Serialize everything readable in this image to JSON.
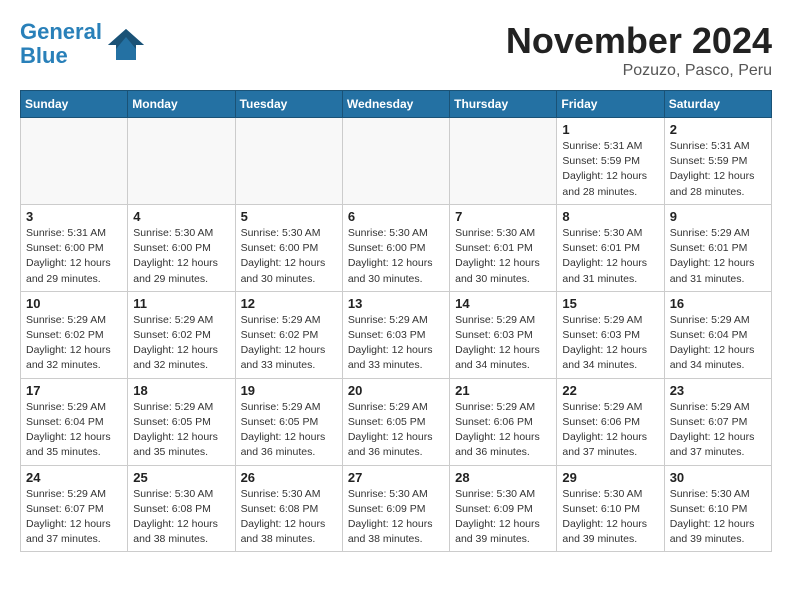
{
  "header": {
    "logo_line1": "General",
    "logo_line2": "Blue",
    "month": "November 2024",
    "location": "Pozuzo, Pasco, Peru"
  },
  "days_of_week": [
    "Sunday",
    "Monday",
    "Tuesday",
    "Wednesday",
    "Thursday",
    "Friday",
    "Saturday"
  ],
  "weeks": [
    [
      {
        "day": "",
        "info": ""
      },
      {
        "day": "",
        "info": ""
      },
      {
        "day": "",
        "info": ""
      },
      {
        "day": "",
        "info": ""
      },
      {
        "day": "",
        "info": ""
      },
      {
        "day": "1",
        "info": "Sunrise: 5:31 AM\nSunset: 5:59 PM\nDaylight: 12 hours and 28 minutes."
      },
      {
        "day": "2",
        "info": "Sunrise: 5:31 AM\nSunset: 5:59 PM\nDaylight: 12 hours and 28 minutes."
      }
    ],
    [
      {
        "day": "3",
        "info": "Sunrise: 5:31 AM\nSunset: 6:00 PM\nDaylight: 12 hours and 29 minutes."
      },
      {
        "day": "4",
        "info": "Sunrise: 5:30 AM\nSunset: 6:00 PM\nDaylight: 12 hours and 29 minutes."
      },
      {
        "day": "5",
        "info": "Sunrise: 5:30 AM\nSunset: 6:00 PM\nDaylight: 12 hours and 30 minutes."
      },
      {
        "day": "6",
        "info": "Sunrise: 5:30 AM\nSunset: 6:00 PM\nDaylight: 12 hours and 30 minutes."
      },
      {
        "day": "7",
        "info": "Sunrise: 5:30 AM\nSunset: 6:01 PM\nDaylight: 12 hours and 30 minutes."
      },
      {
        "day": "8",
        "info": "Sunrise: 5:30 AM\nSunset: 6:01 PM\nDaylight: 12 hours and 31 minutes."
      },
      {
        "day": "9",
        "info": "Sunrise: 5:29 AM\nSunset: 6:01 PM\nDaylight: 12 hours and 31 minutes."
      }
    ],
    [
      {
        "day": "10",
        "info": "Sunrise: 5:29 AM\nSunset: 6:02 PM\nDaylight: 12 hours and 32 minutes."
      },
      {
        "day": "11",
        "info": "Sunrise: 5:29 AM\nSunset: 6:02 PM\nDaylight: 12 hours and 32 minutes."
      },
      {
        "day": "12",
        "info": "Sunrise: 5:29 AM\nSunset: 6:02 PM\nDaylight: 12 hours and 33 minutes."
      },
      {
        "day": "13",
        "info": "Sunrise: 5:29 AM\nSunset: 6:03 PM\nDaylight: 12 hours and 33 minutes."
      },
      {
        "day": "14",
        "info": "Sunrise: 5:29 AM\nSunset: 6:03 PM\nDaylight: 12 hours and 34 minutes."
      },
      {
        "day": "15",
        "info": "Sunrise: 5:29 AM\nSunset: 6:03 PM\nDaylight: 12 hours and 34 minutes."
      },
      {
        "day": "16",
        "info": "Sunrise: 5:29 AM\nSunset: 6:04 PM\nDaylight: 12 hours and 34 minutes."
      }
    ],
    [
      {
        "day": "17",
        "info": "Sunrise: 5:29 AM\nSunset: 6:04 PM\nDaylight: 12 hours and 35 minutes."
      },
      {
        "day": "18",
        "info": "Sunrise: 5:29 AM\nSunset: 6:05 PM\nDaylight: 12 hours and 35 minutes."
      },
      {
        "day": "19",
        "info": "Sunrise: 5:29 AM\nSunset: 6:05 PM\nDaylight: 12 hours and 36 minutes."
      },
      {
        "day": "20",
        "info": "Sunrise: 5:29 AM\nSunset: 6:05 PM\nDaylight: 12 hours and 36 minutes."
      },
      {
        "day": "21",
        "info": "Sunrise: 5:29 AM\nSunset: 6:06 PM\nDaylight: 12 hours and 36 minutes."
      },
      {
        "day": "22",
        "info": "Sunrise: 5:29 AM\nSunset: 6:06 PM\nDaylight: 12 hours and 37 minutes."
      },
      {
        "day": "23",
        "info": "Sunrise: 5:29 AM\nSunset: 6:07 PM\nDaylight: 12 hours and 37 minutes."
      }
    ],
    [
      {
        "day": "24",
        "info": "Sunrise: 5:29 AM\nSunset: 6:07 PM\nDaylight: 12 hours and 37 minutes."
      },
      {
        "day": "25",
        "info": "Sunrise: 5:30 AM\nSunset: 6:08 PM\nDaylight: 12 hours and 38 minutes."
      },
      {
        "day": "26",
        "info": "Sunrise: 5:30 AM\nSunset: 6:08 PM\nDaylight: 12 hours and 38 minutes."
      },
      {
        "day": "27",
        "info": "Sunrise: 5:30 AM\nSunset: 6:09 PM\nDaylight: 12 hours and 38 minutes."
      },
      {
        "day": "28",
        "info": "Sunrise: 5:30 AM\nSunset: 6:09 PM\nDaylight: 12 hours and 39 minutes."
      },
      {
        "day": "29",
        "info": "Sunrise: 5:30 AM\nSunset: 6:10 PM\nDaylight: 12 hours and 39 minutes."
      },
      {
        "day": "30",
        "info": "Sunrise: 5:30 AM\nSunset: 6:10 PM\nDaylight: 12 hours and 39 minutes."
      }
    ]
  ]
}
